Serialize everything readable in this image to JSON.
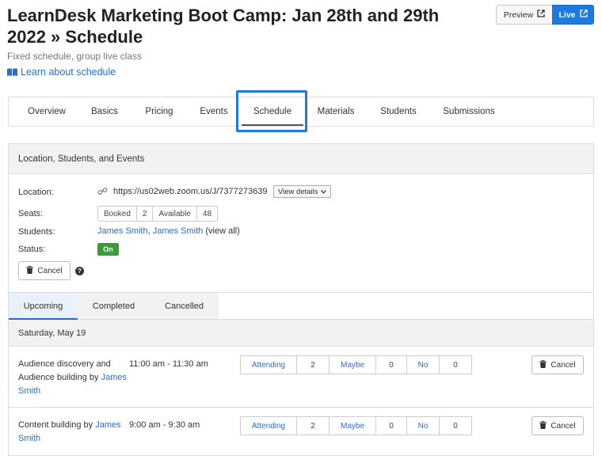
{
  "page": {
    "title": "LearnDesk Marketing Boot Camp: Jan 28th and 29th 2022 » Schedule",
    "subtitle": "Fixed schedule, group live class",
    "learn_link": "Learn about schedule"
  },
  "top_buttons": {
    "preview": "Preview",
    "live": "Live"
  },
  "tabs": [
    {
      "label": "Overview"
    },
    {
      "label": "Basics"
    },
    {
      "label": "Pricing"
    },
    {
      "label": "Events"
    },
    {
      "label": "Schedule",
      "active": true
    },
    {
      "label": "Materials"
    },
    {
      "label": "Students"
    },
    {
      "label": "Submissions"
    }
  ],
  "panel": {
    "header": "Location, Students, and Events",
    "location_label": "Location:",
    "location_url": "https://us02web.zoom.us/J/7377273639",
    "view_details": "View details",
    "seats_label": "Seats:",
    "seats": {
      "booked_label": "Booked",
      "booked": "2",
      "available_label": "Available",
      "available": "48"
    },
    "students_label": "Students:",
    "students": {
      "s1": "James Smith",
      "sep": ", ",
      "s2": "James Smith",
      "view_open": " (",
      "view_all": "view all",
      "view_close": ")"
    },
    "status_label": "Status:",
    "status": "On",
    "cancel": "Cancel",
    "help": "?"
  },
  "subtabs": [
    {
      "label": "Upcoming",
      "active": true
    },
    {
      "label": "Completed"
    },
    {
      "label": "Cancelled"
    }
  ],
  "date_heading": "Saturday, May 19",
  "events": [
    {
      "title": "Audience discovery and Audience building by",
      "host": "James Smith",
      "time": "11:00 am - 11:30 am",
      "attending_label": "Attending",
      "attending": "2",
      "maybe_label": "Maybe",
      "maybe": "0",
      "no_label": "No",
      "no": "0",
      "cancel": "Cancel"
    },
    {
      "title": "Content building by",
      "host": "James Smith",
      "time": "9:00 am - 9:30 am",
      "attending_label": "Attending",
      "attending": "2",
      "maybe_label": "Maybe",
      "maybe": "0",
      "no_label": "No",
      "no": "0",
      "cancel": "Cancel"
    }
  ],
  "colors": {
    "accent": "#1f7ae0",
    "link": "#2a6bd1",
    "status_on": "#3a9b3d"
  },
  "icons": [
    "book-icon",
    "external-link-icon",
    "link-icon",
    "chevron-down-icon",
    "trash-icon",
    "help-icon"
  ]
}
